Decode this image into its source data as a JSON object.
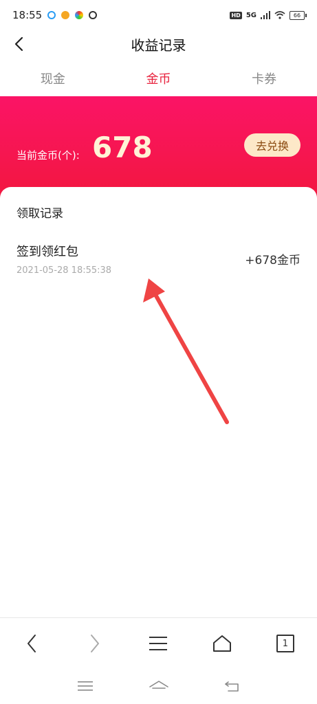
{
  "status": {
    "time": "18:55",
    "network": "5G",
    "hd": "HD",
    "battery": "66"
  },
  "header": {
    "title": "收益记录"
  },
  "tabs": [
    {
      "label": "现金"
    },
    {
      "label": "金币",
      "active": true
    },
    {
      "label": "卡券"
    }
  ],
  "banner": {
    "coin_label": "当前金币(个):",
    "coin_value": "678",
    "exchange_label": "去兑换"
  },
  "records": {
    "section_title": "领取记录",
    "items": [
      {
        "title": "签到领红包",
        "time": "2021-05-28 18:55:38",
        "amount": "+678金币"
      }
    ]
  },
  "toolbar": {
    "tab_count": "1"
  },
  "colors": {
    "accent": "#e8223d",
    "banner_top": "#fb1466",
    "banner_bottom": "#f2173f",
    "exchange_bg": "#fde8c8"
  }
}
